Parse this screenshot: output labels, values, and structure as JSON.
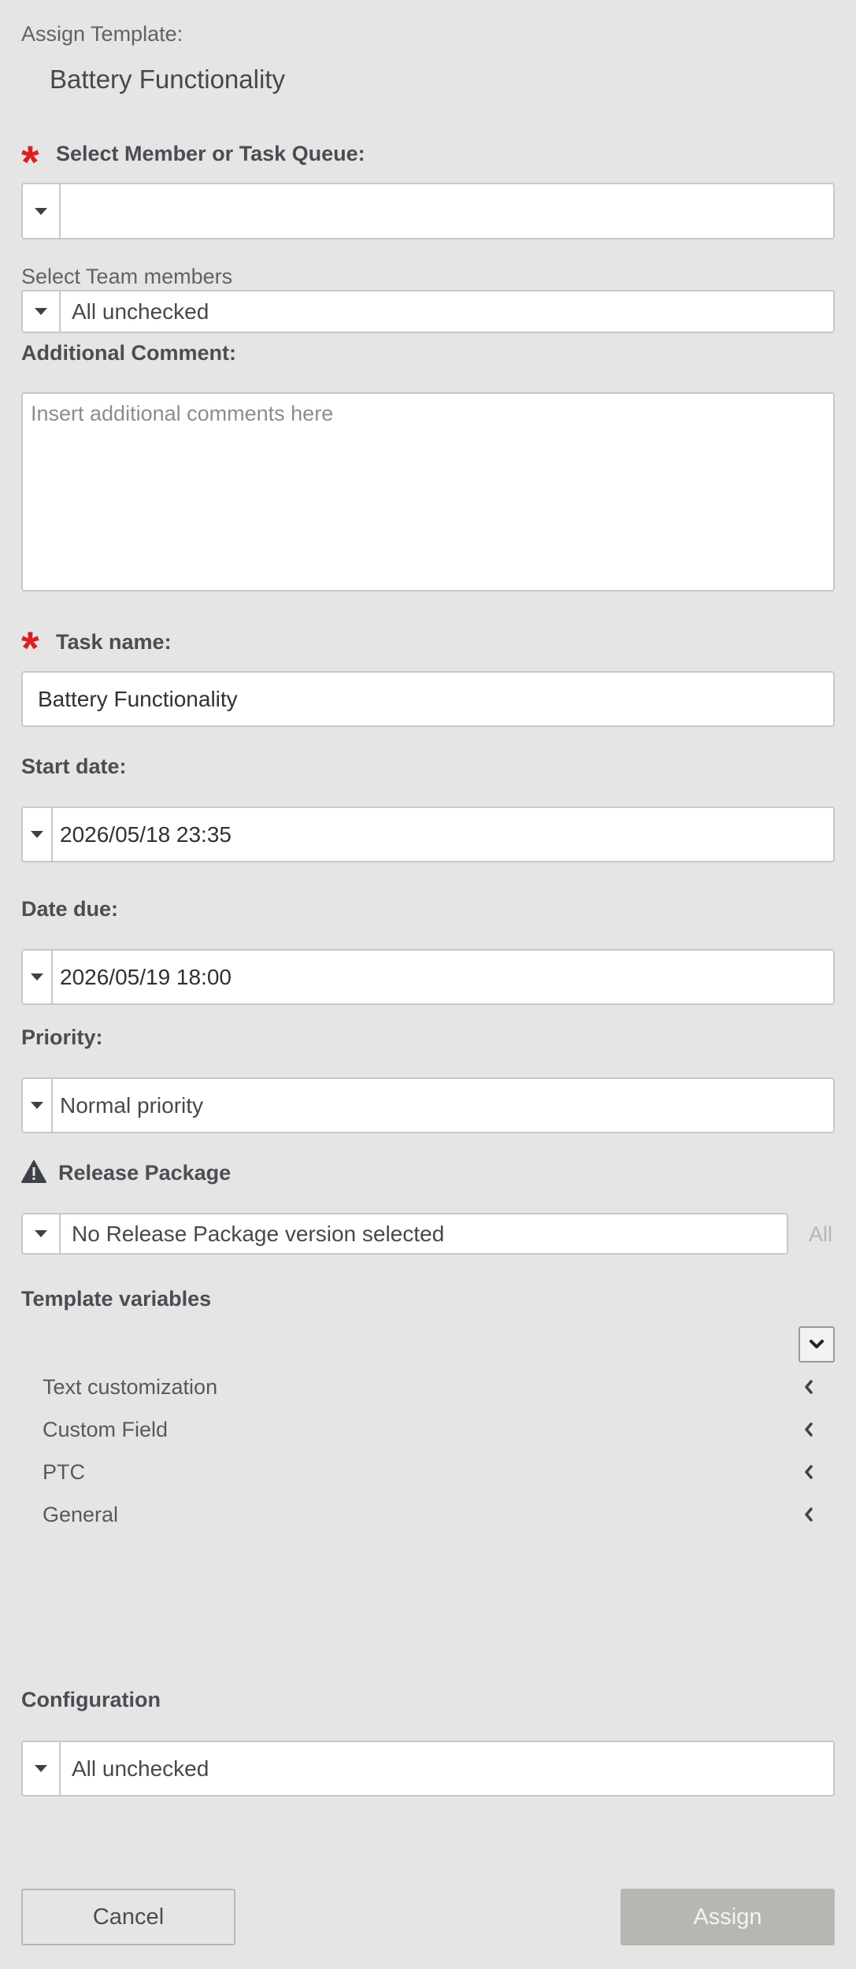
{
  "header": {
    "caption": "Assign Template:",
    "template_name": "Battery Functionality"
  },
  "member_queue": {
    "label": "Select Member or Task Queue:",
    "value": ""
  },
  "team_members": {
    "label": "Select Team members",
    "value": "All unchecked"
  },
  "comment": {
    "label": "Additional Comment:",
    "placeholder": "Insert additional comments here"
  },
  "task_name": {
    "label": "Task name:",
    "value": "Battery Functionality"
  },
  "start_date": {
    "label": "Start date:",
    "value": "2026/05/18 23:35"
  },
  "date_due": {
    "label": "Date due:",
    "value": "2026/05/19 18:00"
  },
  "priority": {
    "label": "Priority:",
    "value": "Normal priority"
  },
  "release_package": {
    "label": "Release Package",
    "value": "No Release Package version selected",
    "all_link": "All"
  },
  "template_variables": {
    "label": "Template variables",
    "items": [
      {
        "label": "Text customization"
      },
      {
        "label": "Custom Field"
      },
      {
        "label": "PTC"
      },
      {
        "label": "General"
      }
    ]
  },
  "configuration": {
    "label": "Configuration",
    "value": "All unchecked"
  },
  "footer": {
    "cancel_label": "Cancel",
    "assign_label": "Assign"
  },
  "colors": {
    "background": "#e5e5e5",
    "required": "#e01e1e",
    "assign_disabled": "#b8b6b3"
  }
}
